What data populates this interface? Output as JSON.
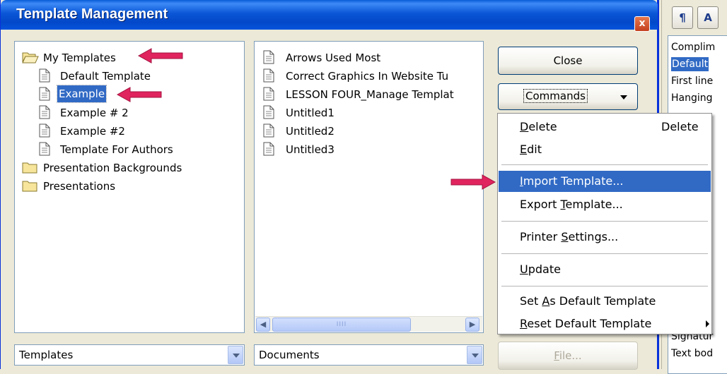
{
  "window": {
    "title": "Template Management",
    "close_glyph": "x"
  },
  "categories": {
    "items": [
      {
        "label": "My Templates",
        "icon": "folder-open-icon"
      },
      {
        "label": "Default Template",
        "icon": "document-icon"
      },
      {
        "label": "Example",
        "icon": "document-icon",
        "selected": true
      },
      {
        "label": "Example # 2",
        "icon": "document-icon"
      },
      {
        "label": "Example #2",
        "icon": "document-icon"
      },
      {
        "label": "Template For Authors",
        "icon": "document-icon"
      },
      {
        "label": "Presentation Backgrounds",
        "icon": "folder-icon"
      },
      {
        "label": "Presentations",
        "icon": "folder-icon"
      }
    ]
  },
  "documents": {
    "items": [
      {
        "label": "Arrows Used Most"
      },
      {
        "label": "Correct Graphics In Website Tu"
      },
      {
        "label": "LESSON FOUR_Manage Templat"
      },
      {
        "label": "Untitled1"
      },
      {
        "label": "Untitled2"
      },
      {
        "label": "Untitled3"
      }
    ],
    "scroll_thumb_grip": "IIII"
  },
  "combos": {
    "left_value": "Templates",
    "right_value": "Documents"
  },
  "buttons": {
    "close": "Close",
    "commands": "Commands",
    "file": "File..."
  },
  "menu": {
    "delete": {
      "pre": "",
      "u": "D",
      "post": "elete",
      "shortcut": "Delete"
    },
    "edit": {
      "pre": "",
      "u": "E",
      "post": "dit"
    },
    "import": {
      "pre": "",
      "u": "I",
      "post": "mport Template..."
    },
    "export": {
      "pre": "Export ",
      "u": "T",
      "post": "emplate..."
    },
    "printer": {
      "pre": "Printer ",
      "u": "S",
      "post": "ettings..."
    },
    "update": {
      "pre": "",
      "u": "U",
      "post": "pdate"
    },
    "set_default": {
      "pre": "Set ",
      "u": "A",
      "post": "s Default Template"
    },
    "reset_default": {
      "pre": "",
      "u": "R",
      "post": "eset Default Template"
    },
    "highlighted": "import"
  },
  "right_panel": {
    "toolbar_paragraph_glyph": "¶",
    "toolbar_char_glyph": "A",
    "styles": [
      {
        "label": "Complim"
      },
      {
        "label": "Default",
        "selected": true
      },
      {
        "label": "First line"
      },
      {
        "label": "Hanging"
      },
      {
        "label": "Signatur"
      },
      {
        "label": "Text bod"
      }
    ]
  },
  "colors": {
    "title_bar": "#0a56d6",
    "selection": "#316ac5",
    "annotation_arrow": "#e0245e"
  }
}
